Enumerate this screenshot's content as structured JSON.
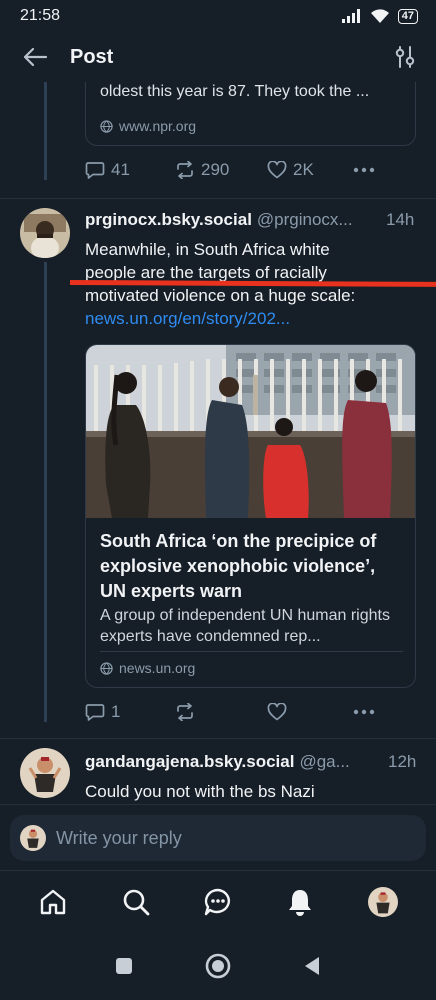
{
  "status": {
    "time": "21:58",
    "battery": "47"
  },
  "header": {
    "title": "Post"
  },
  "prev_post": {
    "card_text": "oldest this year is 87. They took the ...",
    "card_domain": "www.npr.org",
    "replies": "41",
    "reposts": "290",
    "likes": "2K"
  },
  "post": {
    "author": "prginocx.bsky.social",
    "handle": "@prginocx...",
    "time": "14h",
    "text_line1": "Meanwhile, in South Africa white",
    "text_line2": "people are the targets of racially",
    "text_line3": "motivated violence on a huge scale:",
    "link": "news.un.org/en/story/202...",
    "card_title": "South Africa ‘on the precipice of explosive xenophobic violence’, UN experts warn",
    "card_desc": "A group of independent UN human rights experts have condemned rep...",
    "card_domain": "news.un.org",
    "replies": "1"
  },
  "reply_post": {
    "author": "gandangajena.bsky.social",
    "handle": "@ga...",
    "time": "12h",
    "text": "Could you not with the bs Nazi"
  },
  "composer": {
    "placeholder": "Write your reply"
  },
  "colors": {
    "accent": "#2f8cf0",
    "annotation": "#e8321e",
    "background": "#161e27"
  },
  "icons": [
    "back-arrow-icon",
    "filter-sliders-icon",
    "globe-icon",
    "reply-icon",
    "repost-icon",
    "heart-icon",
    "more-icon",
    "home-icon",
    "search-icon",
    "chat-icon",
    "bell-icon",
    "square-icon",
    "circle-icon",
    "triangle-back-icon"
  ]
}
